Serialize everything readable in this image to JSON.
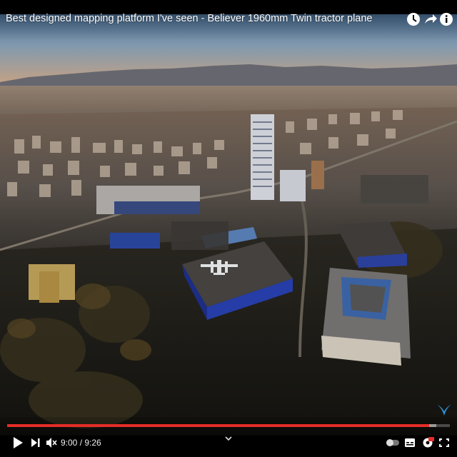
{
  "player": {
    "title": "Best designed mapping platform I've seen - Believer 1960mm Twin tractor plane",
    "time": {
      "current": "9:00",
      "separator": " / ",
      "duration": "9:26"
    },
    "progress_fraction": 0.954,
    "buffered_fraction": 0.97,
    "accent_color": "#e52d27",
    "icons": {
      "top": [
        "clock-icon",
        "share-icon",
        "info-icon"
      ],
      "bottom_left": [
        "play-icon",
        "next-icon",
        "mute-icon"
      ],
      "bottom_right": [
        "autoplay-toggle-icon",
        "subtitles-icon",
        "settings-icon",
        "fullscreen-icon"
      ],
      "center": "chevron-down-icon",
      "watermark": "bird-logo-icon"
    }
  }
}
